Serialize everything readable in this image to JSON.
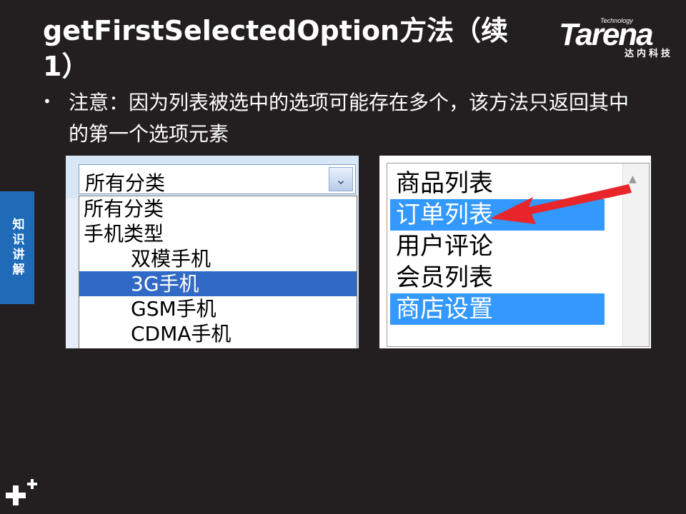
{
  "slide": {
    "title": "getFirstSelectedOption方法（续1）",
    "bullet": "注意：因为列表被选中的选项可能存在多个，该方法只返回其中的第一个选项元素",
    "side_tab": "知识讲解",
    "logo": {
      "tag": "Technology",
      "word": "Tarena",
      "cn": "达内科技"
    }
  },
  "dropdown_example": {
    "selected_value": "所有分类",
    "options": [
      {
        "label": "所有分类",
        "indent": false,
        "selected": false
      },
      {
        "label": "手机类型",
        "indent": false,
        "selected": false
      },
      {
        "label": "双模手机",
        "indent": true,
        "selected": false
      },
      {
        "label": "3G手机",
        "indent": true,
        "selected": true
      },
      {
        "label": "GSM手机",
        "indent": true,
        "selected": false
      },
      {
        "label": "CDMA手机",
        "indent": true,
        "selected": false
      }
    ]
  },
  "listbox_example": {
    "options": [
      {
        "label": "商品列表",
        "selected": false
      },
      {
        "label": "订单列表",
        "selected": true
      },
      {
        "label": "用户评论",
        "selected": false
      },
      {
        "label": "会员列表",
        "selected": false
      },
      {
        "label": "商店设置",
        "selected": true
      }
    ]
  },
  "colors": {
    "background": "#231f20",
    "side_tab": "#1f6bb8",
    "dropdown_highlight": "#3169c6",
    "listbox_highlight": "#3399ff",
    "arrow": "#e8252a"
  }
}
